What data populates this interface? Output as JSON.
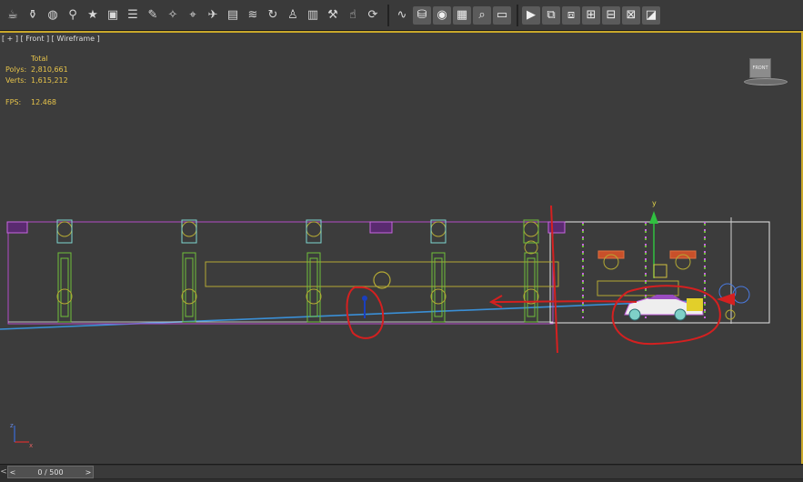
{
  "toolbar": {
    "icons": [
      "teapot-icon",
      "kettle-icon",
      "sphere-icon",
      "gizmo-icon",
      "star-icon",
      "box-icon",
      "cylinder-stack-icon",
      "wand-icon",
      "wrench-icon",
      "transform-icon",
      "bird-icon",
      "cloth-icon",
      "wave-icon",
      "loop-icon",
      "figure-icon",
      "scroll-icon",
      "tool-icon",
      "hand-icon",
      "motion-icon",
      "hair-icon",
      "material-icon",
      "render-sphere-icon",
      "panel-icon",
      "render-setup-icon",
      "frame-render-icon",
      "render-icon",
      "object-icon-1",
      "object-icon-2",
      "object-icon-3",
      "layers-icon-1",
      "layers-icon-2",
      "graph-icon"
    ]
  },
  "viewport": {
    "label": "[ + ] [ Front ] [ Wireframe ]",
    "stats": {
      "header": "Total",
      "polys_label": "Polys:",
      "polys_value": "2,810,661",
      "verts_label": "Verts:",
      "verts_value": "1,615,212",
      "fps_label": "FPS:",
      "fps_value": "12.468"
    },
    "viewcube_label": "FRONT",
    "gizmo_axis_label": "y",
    "tripod_x": "x",
    "tripod_z": "z"
  },
  "timeline": {
    "slider_text": "0 / 500",
    "prev_arrow": "<",
    "next_arrow": ">"
  },
  "colors": {
    "viewport_border": "#c9a82a",
    "stats_text": "#e6c34a",
    "wire_green": "#6fbf3a",
    "wire_olive": "#b4a934",
    "wire_purple": "#b44cc8",
    "annotation_red": "#d42020",
    "horizon_blue": "#3a8fd6"
  }
}
